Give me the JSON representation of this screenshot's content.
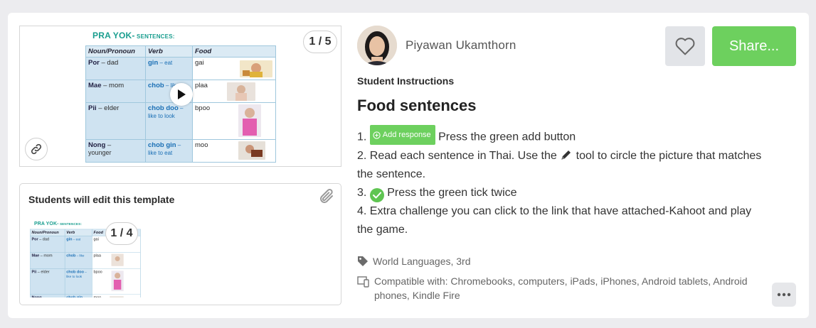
{
  "preview": {
    "counter": "1 / 5",
    "slide": {
      "title_main": "PRA YOK-",
      "title_sub": " SENTENCES:",
      "headers": [
        "Noun/Pronoun",
        "Verb",
        "Food"
      ],
      "rows": [
        {
          "noun": "Por",
          "noun_meaning": " – dad",
          "noun_extra": "",
          "verb": "gin",
          "verb_meaning": " – eat",
          "verb_extra": "",
          "food": "gai"
        },
        {
          "noun": "Mae",
          "noun_meaning": " – mom",
          "noun_extra": "",
          "verb": "chob",
          "verb_meaning": " – like",
          "verb_extra": "",
          "food": "plaa"
        },
        {
          "noun": "Pii",
          "noun_meaning": " – elder",
          "noun_extra": "",
          "verb": "chob doo",
          "verb_meaning": " –",
          "verb_extra": "like to look",
          "food": "bpoo"
        },
        {
          "noun": "Nong",
          "noun_meaning": " –",
          "noun_extra": "younger",
          "verb": "chob gin",
          "verb_meaning": " –",
          "verb_extra": "like to eat",
          "food": "moo"
        }
      ]
    }
  },
  "template": {
    "label": "Students will edit this template",
    "counter": "1 / 4"
  },
  "author": {
    "name": "Piyawan Ukamthorn"
  },
  "actions": {
    "share_label": "Share..."
  },
  "instructions": {
    "label": "Student Instructions",
    "title": "Food sentences",
    "step1_prefix": "1. ",
    "add_response_label": "Add response",
    "step1_text": " Press the green add button",
    "step2_text_a": "2. Read each sentence in Thai. Use the ",
    "step2_text_b": " tool to circle the picture that matches the sentence.",
    "step3_prefix": "3. ",
    "step3_text": " Press the green tick twice",
    "step4_text": "4. Extra challenge you can click to the link that have attached-Kahoot and play the game."
  },
  "meta": {
    "subject": "World Languages, 3rd",
    "compatible": "Compatible with: Chromebooks, computers, iPads, iPhones, Android tablets, Android phones, Kindle Fire"
  },
  "colors": {
    "accent_green": "#6dd05e",
    "slide_teal": "#1a9e8f",
    "verb_blue": "#1a6fb5"
  }
}
